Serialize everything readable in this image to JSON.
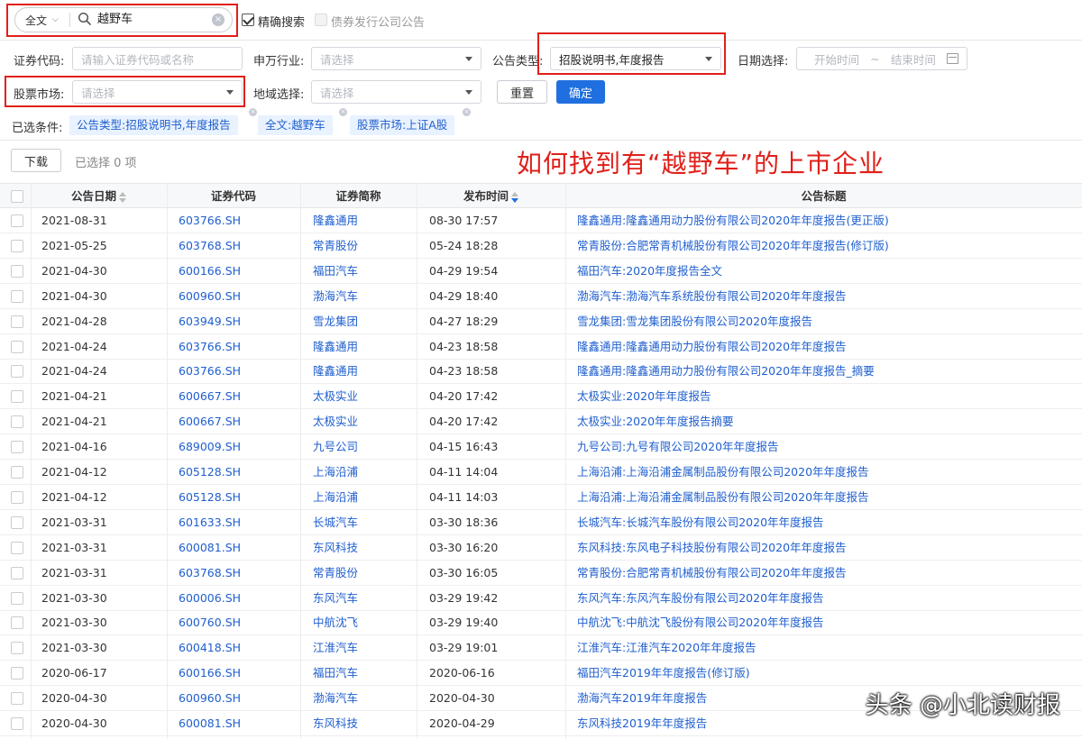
{
  "search": {
    "scope": "全文",
    "query": "越野车",
    "exact_label": "精确搜索",
    "exact_checked": true,
    "bond_label": "债券发行公司公告"
  },
  "filters": {
    "code_label": "证券代码:",
    "code_placeholder": "请输入证券代码或名称",
    "industry_label": "申万行业:",
    "industry_placeholder": "请选择",
    "type_label": "公告类型:",
    "type_value": "招股说明书,年度报告",
    "date_label": "日期选择:",
    "date_start": "开始时间",
    "date_sep": "~",
    "date_end": "结束时间",
    "market_label": "股票市场:",
    "market_placeholder": "请选择",
    "region_label": "地域选择:",
    "region_placeholder": "请选择",
    "reset_label": "重置",
    "confirm_label": "确定"
  },
  "selected": {
    "label": "已选条件:",
    "tags": [
      "公告类型:招股说明书,年度报告",
      "全文:越野车",
      "股票市场:上证A股"
    ]
  },
  "toolbar": {
    "download_label": "下载",
    "selected_count": "已选择 0 项"
  },
  "annotation": "如何找到有“越野车”的上市企业",
  "table": {
    "headers": [
      "公告日期",
      "证券代码",
      "证券简称",
      "发布时间",
      "公告标题"
    ],
    "rows": [
      {
        "date": "2021-08-31",
        "code": "603766.SH",
        "name": "隆鑫通用",
        "time": "08-30 17:57",
        "title": "隆鑫通用:隆鑫通用动力股份有限公司2020年年度报告(更正版)"
      },
      {
        "date": "2021-05-25",
        "code": "603768.SH",
        "name": "常青股份",
        "time": "05-24 18:28",
        "title": "常青股份:合肥常青机械股份有限公司2020年年度报告(修订版)"
      },
      {
        "date": "2021-04-30",
        "code": "600166.SH",
        "name": "福田汽车",
        "time": "04-29 19:54",
        "title": "福田汽车:2020年度报告全文"
      },
      {
        "date": "2021-04-30",
        "code": "600960.SH",
        "name": "渤海汽车",
        "time": "04-29 18:40",
        "title": "渤海汽车:渤海汽车系统股份有限公司2020年年度报告"
      },
      {
        "date": "2021-04-28",
        "code": "603949.SH",
        "name": "雪龙集团",
        "time": "04-27 18:29",
        "title": "雪龙集团:雪龙集团股份有限公司2020年度报告"
      },
      {
        "date": "2021-04-24",
        "code": "603766.SH",
        "name": "隆鑫通用",
        "time": "04-23 18:58",
        "title": "隆鑫通用:隆鑫通用动力股份有限公司2020年年度报告"
      },
      {
        "date": "2021-04-24",
        "code": "603766.SH",
        "name": "隆鑫通用",
        "time": "04-23 18:58",
        "title": "隆鑫通用:隆鑫通用动力股份有限公司2020年年度报告_摘要"
      },
      {
        "date": "2021-04-21",
        "code": "600667.SH",
        "name": "太极实业",
        "time": "04-20 17:42",
        "title": "太极实业:2020年年度报告"
      },
      {
        "date": "2021-04-21",
        "code": "600667.SH",
        "name": "太极实业",
        "time": "04-20 17:42",
        "title": "太极实业:2020年年度报告摘要"
      },
      {
        "date": "2021-04-16",
        "code": "689009.SH",
        "name": "九号公司",
        "time": "04-15 16:43",
        "title": "九号公司:九号有限公司2020年年度报告"
      },
      {
        "date": "2021-04-12",
        "code": "605128.SH",
        "name": "上海沿浦",
        "time": "04-11 14:04",
        "title": "上海沿浦:上海沿浦金属制品股份有限公司2020年年度报告"
      },
      {
        "date": "2021-04-12",
        "code": "605128.SH",
        "name": "上海沿浦",
        "time": "04-11 14:03",
        "title": "上海沿浦:上海沿浦金属制品股份有限公司2020年年度报告"
      },
      {
        "date": "2021-03-31",
        "code": "601633.SH",
        "name": "长城汽车",
        "time": "03-30 18:36",
        "title": "长城汽车:长城汽车股份有限公司2020年年度报告"
      },
      {
        "date": "2021-03-31",
        "code": "600081.SH",
        "name": "东风科技",
        "time": "03-30 16:20",
        "title": "东风科技:东风电子科技股份有限公司2020年年度报告"
      },
      {
        "date": "2021-03-31",
        "code": "603768.SH",
        "name": "常青股份",
        "time": "03-30 16:05",
        "title": "常青股份:合肥常青机械股份有限公司2020年年度报告"
      },
      {
        "date": "2021-03-30",
        "code": "600006.SH",
        "name": "东风汽车",
        "time": "03-29 19:42",
        "title": "东风汽车:东风汽车股份有限公司2020年年度报告"
      },
      {
        "date": "2021-03-30",
        "code": "600760.SH",
        "name": "中航沈飞",
        "time": "03-29 19:40",
        "title": "中航沈飞:中航沈飞股份有限公司2020年年度报告"
      },
      {
        "date": "2021-03-30",
        "code": "600418.SH",
        "name": "江淮汽车",
        "time": "03-29 19:01",
        "title": "江淮汽车:江淮汽车2020年年度报告"
      },
      {
        "date": "2020-06-17",
        "code": "600166.SH",
        "name": "福田汽车",
        "time": "2020-06-16",
        "title": "福田汽车2019年年度报告(修订版)"
      },
      {
        "date": "2020-04-30",
        "code": "600960.SH",
        "name": "渤海汽车",
        "time": "2020-04-30",
        "title": "渤海汽车2019年年度报告"
      },
      {
        "date": "2020-04-30",
        "code": "600081.SH",
        "name": "东风科技",
        "time": "2020-04-29",
        "title": "东风科技2019年年度报告"
      }
    ]
  },
  "watermark": "头条 @小北读财报",
  "colors": {
    "accent": "#1f6fe0",
    "link": "#1f5fcf",
    "highlight": "#e0201a",
    "tag_bg": "#e9f2ff"
  }
}
